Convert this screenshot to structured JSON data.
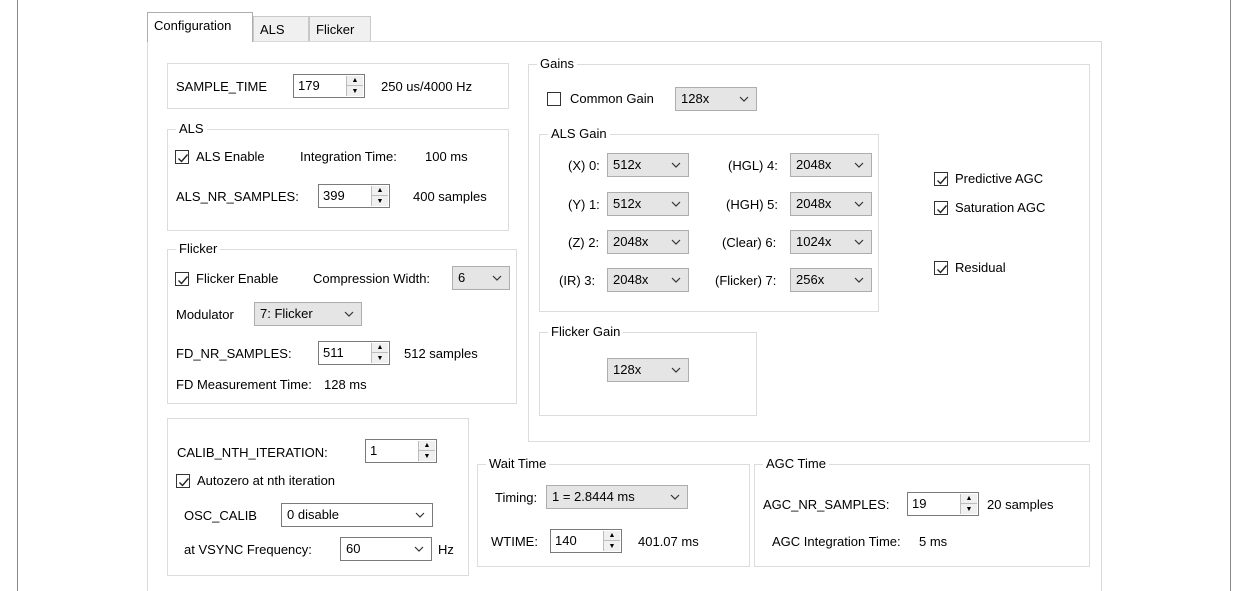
{
  "tabs": [
    {
      "label": "Configuration",
      "active": true
    },
    {
      "label": "ALS",
      "active": false
    },
    {
      "label": "Flicker",
      "active": false
    }
  ],
  "sample_time": {
    "label": "SAMPLE_TIME",
    "value": "179",
    "info": "250 us/4000 Hz"
  },
  "als": {
    "title": "ALS",
    "enable_label": "ALS Enable",
    "enable_checked": true,
    "integration_label": "Integration Time:",
    "integration_value": "100 ms",
    "nr_samples_label": "ALS_NR_SAMPLES:",
    "nr_samples_value": "399",
    "nr_samples_info": "400 samples"
  },
  "flicker": {
    "title": "Flicker",
    "enable_label": "Flicker Enable",
    "enable_checked": true,
    "compression_label": "Compression Width:",
    "compression_value": "6",
    "modulator_label": "Modulator",
    "modulator_value": "7: Flicker",
    "fd_nr_label": "FD_NR_SAMPLES:",
    "fd_nr_value": "511",
    "fd_nr_info": "512 samples",
    "fd_time_label": "FD Measurement Time:",
    "fd_time_value": "128 ms"
  },
  "calib": {
    "nth_label": "CALIB_NTH_ITERATION:",
    "nth_value": "1",
    "autozero_label": "Autozero at nth iteration",
    "autozero_checked": true,
    "osc_label": "OSC_CALIB",
    "osc_value": "0 disable",
    "vsync_label": "at VSYNC Frequency:",
    "vsync_value": "60",
    "vsync_unit": "Hz"
  },
  "gains": {
    "title": "Gains",
    "common_label": "Common Gain",
    "common_checked": false,
    "common_value": "128x",
    "als_gain_title": "ALS Gain",
    "channels": [
      {
        "label": "(X) 0:",
        "value": "512x"
      },
      {
        "label": "(Y) 1:",
        "value": "512x"
      },
      {
        "label": "(Z) 2:",
        "value": "2048x"
      },
      {
        "label": "(IR) 3:",
        "value": "2048x"
      },
      {
        "label": "(HGL) 4:",
        "value": "2048x"
      },
      {
        "label": "(HGH) 5:",
        "value": "2048x"
      },
      {
        "label": "(Clear) 6:",
        "value": "1024x"
      },
      {
        "label": "(Flicker) 7:",
        "value": "256x"
      }
    ],
    "flicker_gain_title": "Flicker Gain",
    "flicker_gain_value": "128x",
    "predictive_label": "Predictive AGC",
    "predictive_checked": true,
    "saturation_label": "Saturation AGC",
    "saturation_checked": true,
    "residual_label": "Residual",
    "residual_checked": true
  },
  "wait_time": {
    "title": "Wait Time",
    "timing_label": "Timing:",
    "timing_value": "1 = 2.8444 ms",
    "wtime_label": "WTIME:",
    "wtime_value": "140",
    "wtime_info": "401.07 ms"
  },
  "agc_time": {
    "title": "AGC Time",
    "nr_label": "AGC_NR_SAMPLES:",
    "nr_value": "19",
    "nr_info": "20 samples",
    "integration_label": "AGC Integration Time:",
    "integration_value": "5 ms"
  },
  "icons": {
    "check": "check-icon",
    "spin_up": "spin-up-icon",
    "spin_down": "spin-down-icon",
    "dropdown": "chevron-down-icon"
  }
}
